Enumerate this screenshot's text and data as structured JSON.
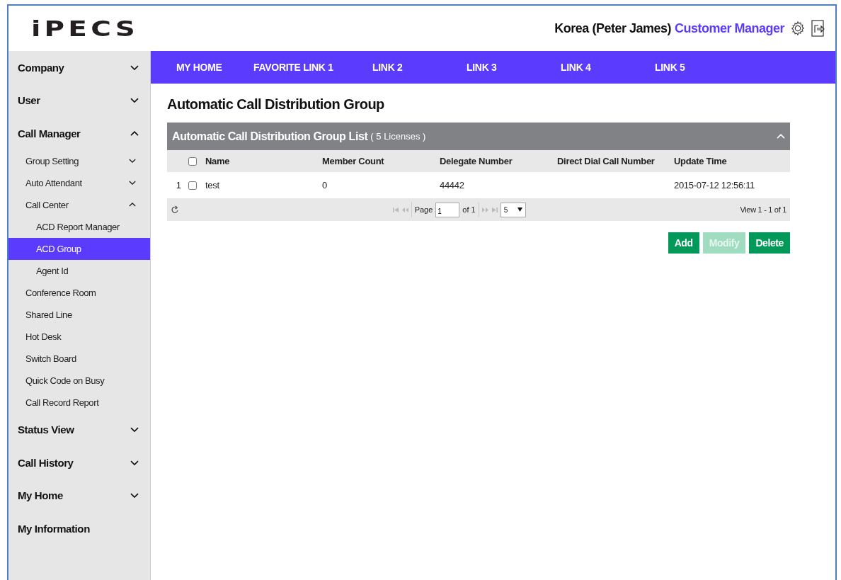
{
  "header": {
    "logo": "iPECS",
    "user": "Korea (Peter James)",
    "role_link": "Customer Manager"
  },
  "nav": [
    {
      "label": "MY HOME"
    },
    {
      "label": "FAVORITE LINK 1"
    },
    {
      "label": "LINK 2"
    },
    {
      "label": "LINK 3"
    },
    {
      "label": "LINK 4"
    },
    {
      "label": "LINK 5"
    }
  ],
  "sidebar": {
    "items": [
      {
        "label": "Company",
        "expanded": false,
        "selected": false
      },
      {
        "label": "User",
        "expanded": false,
        "selected": false
      },
      {
        "label": "Call Manager",
        "expanded": true,
        "selected": false,
        "children": [
          {
            "label": "Group Setting",
            "expanded": false,
            "selected": false
          },
          {
            "label": "Auto Attendant",
            "expanded": false,
            "selected": false
          },
          {
            "label": "Call Center",
            "expanded": true,
            "selected": false,
            "children": [
              {
                "label": "ACD Report Manager",
                "selected": false
              },
              {
                "label": "ACD Group",
                "selected": true
              },
              {
                "label": "Agent Id",
                "selected": false
              }
            ]
          },
          {
            "label": "Conference Room",
            "selected": false
          },
          {
            "label": "Shared Line",
            "selected": false
          },
          {
            "label": "Hot Desk",
            "selected": false
          },
          {
            "label": "Switch Board",
            "selected": false
          },
          {
            "label": "Quick Code on Busy",
            "selected": false
          },
          {
            "label": "Call Record Report",
            "selected": false
          }
        ]
      },
      {
        "label": "Status View",
        "expanded": false,
        "selected": false
      },
      {
        "label": "Call History",
        "expanded": false,
        "selected": false
      },
      {
        "label": "My Home",
        "expanded": false,
        "selected": false
      },
      {
        "label": "My Information",
        "selected": false
      }
    ]
  },
  "page_title": "Automatic Call Distribution Group",
  "panel": {
    "title": "Automatic Call Distribution Group List",
    "licenses": "( 5 Licenses )",
    "expanded": true,
    "columns": [
      "Name",
      "Member Count",
      "Delegate Number",
      "Direct Dial Call Number",
      "Update Time"
    ],
    "header_checked": false,
    "rows": [
      {
        "number": "1",
        "checked": false,
        "cells": [
          "test",
          "0",
          "44442",
          "",
          "2015-07-12 12:56:11"
        ]
      }
    ],
    "pager": {
      "page_label": "Page",
      "page": "1",
      "of": "of 1",
      "page_size": "5",
      "view": "View 1 - 1 of 1"
    }
  },
  "buttons": [
    {
      "label": "Add",
      "disabled": false
    },
    {
      "label": "Modify",
      "disabled": true
    },
    {
      "label": "Delete",
      "disabled": false
    }
  ]
}
